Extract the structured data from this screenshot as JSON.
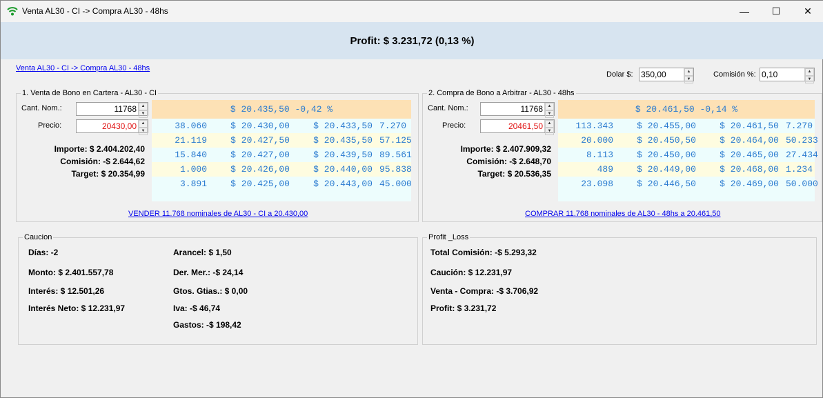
{
  "window": {
    "title": "Venta AL30 - CI -> Compra AL30 - 48hs",
    "minimize": "—",
    "maximize": "☐",
    "close": "✕"
  },
  "header": {
    "profit": "Profit: $ 3.231,72 (0,13 %)"
  },
  "top": {
    "link": "Venta AL30 - CI -> Compra AL30 - 48hs",
    "dolar_label": "Dolar $:",
    "dolar_value": "350,00",
    "comision_label": "Comisión %:",
    "comision_value": "0,10"
  },
  "venta": {
    "title": "1. Venta de Bono en Cartera - AL30 - CI",
    "cant_label": "Cant. Nom.:",
    "cant_value": "11768",
    "precio_label": "Precio:",
    "precio_value": "20430,00",
    "importe": "Importe: $ 2.404.202,40",
    "comision": "Comisión: -$ 2.644,62",
    "target": "Target: $ 20.354,99",
    "book_header": "$ 20.435,50 -0,42 %",
    "rows": [
      [
        "38.060",
        "$ 20.430,00",
        "$ 20.433,50",
        "7.270"
      ],
      [
        "21.119",
        "$ 20.427,50",
        "$ 20.435,50",
        "57.125"
      ],
      [
        "15.840",
        "$ 20.427,00",
        "$ 20.439,50",
        "89.561"
      ],
      [
        "1.000",
        "$ 20.426,00",
        "$ 20.440,00",
        "95.838"
      ],
      [
        "3.891",
        "$ 20.425,00",
        "$ 20.443,00",
        "45.000"
      ]
    ],
    "action": "VENDER 11.768 nominales de AL30 - CI a 20.430,00"
  },
  "compra": {
    "title": "2. Compra de Bono a Arbitrar - AL30 - 48hs",
    "cant_label": "Cant. Nom.:",
    "cant_value": "11768",
    "precio_label": "Precio:",
    "precio_value": "20461,50",
    "importe": "Importe: $ 2.407.909,32",
    "comision": "Comisión: -$ 2.648,70",
    "target": "Target: $ 20.536,35",
    "book_header": "$ 20.461,50 -0,14 %",
    "rows": [
      [
        "113.343",
        "$ 20.455,00",
        "$ 20.461,50",
        "7.270"
      ],
      [
        "20.000",
        "$ 20.450,50",
        "$ 20.464,00",
        "50.233"
      ],
      [
        "8.113",
        "$ 20.450,00",
        "$ 20.465,00",
        "27.434"
      ],
      [
        "489",
        "$ 20.449,00",
        "$ 20.468,00",
        "1.234"
      ],
      [
        "23.098",
        "$ 20.446,50",
        "$ 20.469,00",
        "50.000"
      ]
    ],
    "action": "COMPRAR 11.768 nominales de AL30 - 48hs a 20.461,50"
  },
  "caucion": {
    "title": "Caucion",
    "dias": "Días: -2",
    "monto": "Monto: $ 2.401.557,78",
    "interes": "Interés: $ 12.501,26",
    "interes_neto": "Interés Neto: $ 12.231,97",
    "arancel": "Arancel: $ 1,50",
    "der_mer": "Der. Mer.: -$ 24,14",
    "gtos": "Gtos. Gtias.: $ 0,00",
    "iva": "Iva: -$ 46,74",
    "gastos": "Gastos: -$ 198,42"
  },
  "pl": {
    "title": "Profit _Loss",
    "total_comision": "Total Comisión: -$ 5.293,32",
    "caucion": "Caución: $ 12.231,97",
    "venta_compra": "Venta - Compra: -$ 3.706,92",
    "profit": "Profit: $ 3.231,72"
  }
}
